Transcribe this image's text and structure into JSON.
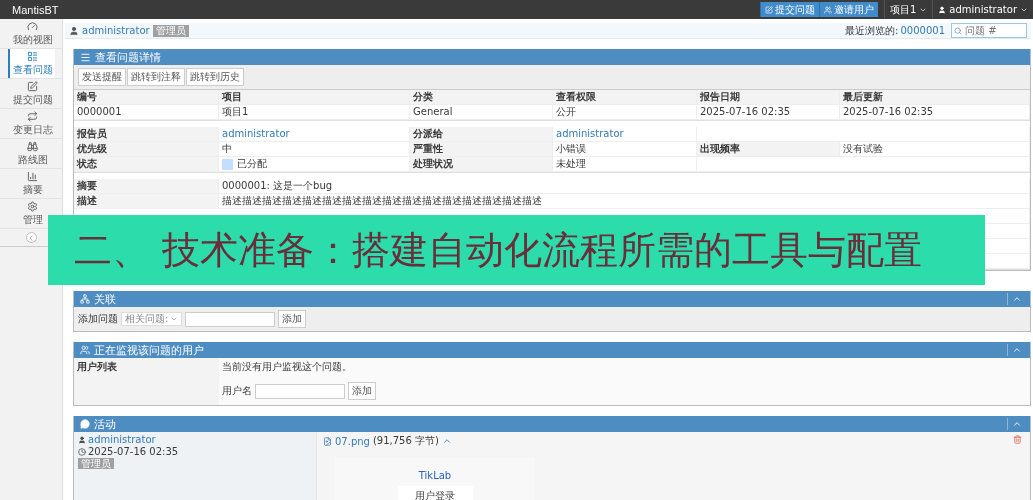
{
  "topbar": {
    "brand": "MantisBT",
    "actions": [
      {
        "label": "提交问题"
      },
      {
        "label": "邀请用户"
      }
    ],
    "project": "项目1",
    "user": "administrator"
  },
  "sidebar": {
    "items": [
      {
        "label": "我的视图",
        "selected": false
      },
      {
        "label": "查看问题",
        "selected": true
      },
      {
        "label": "提交问题",
        "selected": false
      },
      {
        "label": "变更日志",
        "selected": false
      },
      {
        "label": "路线图",
        "selected": false
      },
      {
        "label": "摘要",
        "selected": false
      },
      {
        "label": "管理",
        "selected": false
      }
    ]
  },
  "breadcrumb": {
    "user": "administrator",
    "role": "管理员",
    "recent_label": "最近浏览的:",
    "recent_issue": "0000001",
    "search": {
      "placeholder": "问题 #"
    }
  },
  "details": {
    "title": "查看问题详情",
    "buttons": [
      "发送提醒",
      "跳转到注释",
      "跳转到历史"
    ],
    "groups": [
      [
        [
          {
            "kind": "label",
            "text": "编号"
          },
          {
            "kind": "label",
            "text": "项目"
          },
          {
            "kind": "label",
            "text": "分类"
          },
          {
            "kind": "label",
            "text": "查看权限"
          },
          {
            "kind": "label",
            "text": "报告日期"
          },
          {
            "kind": "label",
            "text": "最后更新"
          }
        ],
        [
          {
            "kind": "text",
            "text": "0000001"
          },
          {
            "kind": "text",
            "text": "项目1"
          },
          {
            "kind": "text",
            "text": "General"
          },
          {
            "kind": "text",
            "text": "公开"
          },
          {
            "kind": "text",
            "text": "2025-07-16 02:35"
          },
          {
            "kind": "text",
            "text": "2025-07-16 02:35"
          }
        ]
      ],
      [
        [
          {
            "kind": "label",
            "text": "报告员"
          },
          {
            "kind": "link",
            "text": "administrator"
          },
          {
            "kind": "label",
            "text": "分派给"
          },
          {
            "kind": "link",
            "text": "administrator"
          },
          {
            "kind": "empty"
          }
        ],
        [
          {
            "kind": "label",
            "text": "优先级"
          },
          {
            "kind": "text",
            "text": "中"
          },
          {
            "kind": "label",
            "text": "严重性"
          },
          {
            "kind": "text",
            "text": "小错误"
          },
          {
            "kind": "label",
            "text": "出现频率"
          },
          {
            "kind": "text",
            "text": "没有试验"
          }
        ],
        [
          {
            "kind": "label",
            "text": "状态"
          },
          {
            "kind": "status",
            "text": "已分配",
            "color": "#c2dfff"
          },
          {
            "kind": "label",
            "text": "处理状况"
          },
          {
            "kind": "text",
            "text": "未处理"
          },
          {
            "kind": "empty"
          }
        ]
      ],
      [
        [
          {
            "kind": "label",
            "text": "摘要"
          },
          {
            "kind": "text",
            "text": "0000001: 这是一个bug"
          }
        ],
        [
          {
            "kind": "label",
            "text": "描述"
          },
          {
            "kind": "text",
            "text": "描述描述描述描述描述描述描述描述描述描述描述描述描述描述描述描述"
          }
        ],
        [
          {
            "kind": "empty"
          }
        ],
        [
          {
            "kind": "empty"
          }
        ],
        [
          {
            "kind": "empty"
          }
        ],
        [
          {
            "kind": "empty"
          }
        ]
      ]
    ]
  },
  "banner": {
    "text": "二、 技术准备：搭建自动化流程所需的工具与配置"
  },
  "relations": {
    "title": "关联",
    "label": "添加问题",
    "select": "相关问题:",
    "button": "添加"
  },
  "monitor": {
    "title": "正在监视该问题的用户",
    "label": "用户列表",
    "message": "当前没有用户监视这个问题。",
    "field_label": "用户名",
    "button": "添加"
  },
  "activity": {
    "title": "活动",
    "author": "administrator",
    "date": "2025-07-16 02:35",
    "role": "管理员",
    "file": "07.png",
    "size": "(91,756 字节)",
    "preview": {
      "brand": "TikLab",
      "heading": "用户登录"
    }
  }
}
